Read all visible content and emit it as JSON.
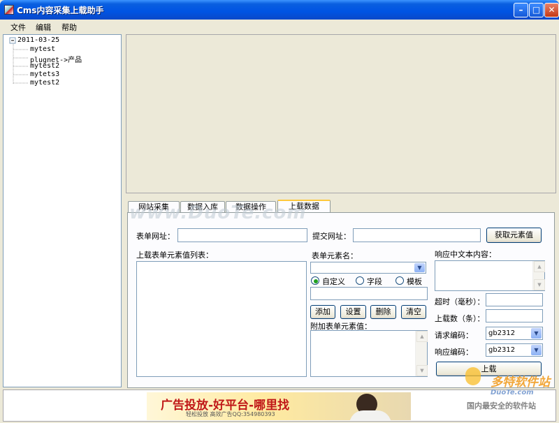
{
  "window": {
    "title": "Cms内容采集上载助手"
  },
  "menu": [
    "文件",
    "编辑",
    "帮助"
  ],
  "tree": {
    "root": "2011-03-25",
    "children": [
      "mytest",
      "plugnet->产品",
      "mytest2",
      "mytets3",
      "mytest2"
    ]
  },
  "tabs": [
    "网站采集",
    "数据入库",
    "数据操作",
    "上载数据"
  ],
  "active_tab": "上载数据",
  "form": {
    "form_url_label": "表单网址：",
    "form_url_value": "",
    "submit_url_label": "提交网址：",
    "submit_url_value": "",
    "get_elements_label": "获取元素值",
    "element_list_label": "上载表单元素值列表：",
    "element_name_label": "表单元素名：",
    "radio_custom": "自定义",
    "radio_field": "字段",
    "radio_template": "模板",
    "selected_radio": "自定义",
    "add_label": "添加",
    "set_label": "设置",
    "delete_label": "删除",
    "clear_label": "清空",
    "extra_values_label": "附加表单元素值：",
    "response_text_label": "响应中文本内容：",
    "timeout_label": "超时（毫秒）：",
    "upload_count_label": "上载数（条）：",
    "request_encoding_label": "请求编码：",
    "request_encoding_value": "gb2312",
    "response_encoding_label": "响应编码：",
    "response_encoding_value": "gb2312",
    "upload_label": "上载"
  },
  "watermark": "www.DuoTe.com",
  "ad": {
    "headline": "广告投放-好平台-哪里找",
    "subline": "轻松投放 高效广告QQ:354980393"
  },
  "site_logo": {
    "name": "多特软件站",
    "domain": "DuoTe.com",
    "slogan": "国内最安全的软件站"
  },
  "colors": {
    "titlebar": "#0054e3",
    "tab_highlight": "#ffc83c",
    "window_bg": "#ece9d8",
    "ad_text": "#c01818"
  }
}
